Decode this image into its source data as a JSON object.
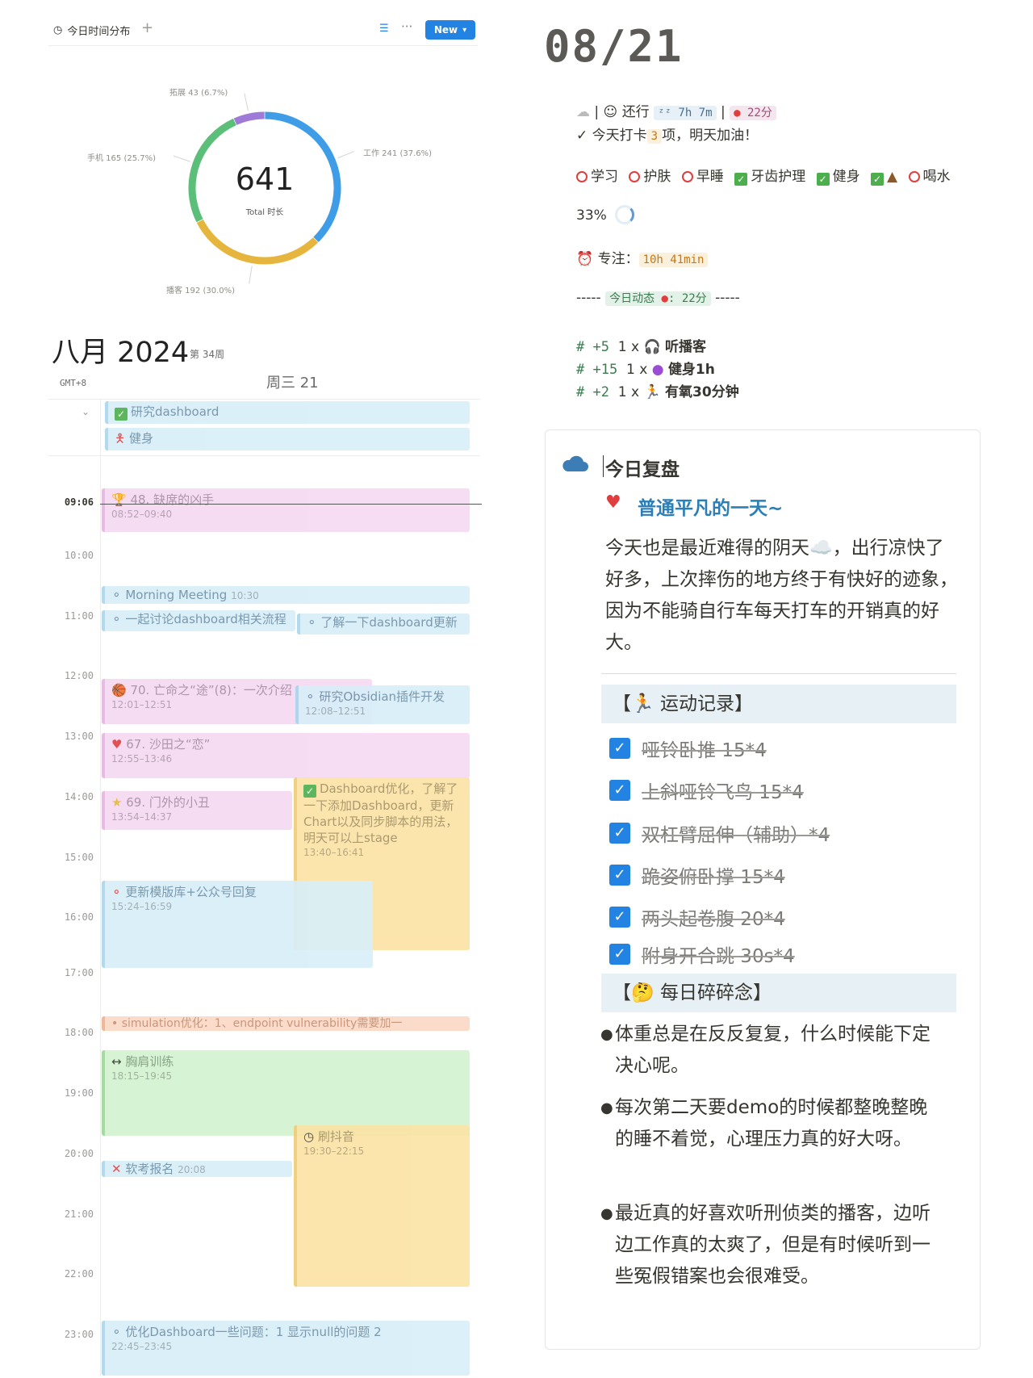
{
  "header": {
    "view_title": "今日时间分布",
    "add": "+",
    "more": "···",
    "new_label": "New"
  },
  "chart_data": {
    "type": "pie",
    "title": "",
    "total": "641",
    "total_label": "Total 时长",
    "slices": [
      {
        "name": "工作",
        "value": 241,
        "pct": "37.6%",
        "color": "#3e9de6",
        "label": "工作 241 (37.6%)"
      },
      {
        "name": "播客",
        "value": 192,
        "pct": "30.0%",
        "color": "#e5b53e",
        "label": "播客 192 (30.0%)"
      },
      {
        "name": "手机",
        "value": 165,
        "pct": "25.7%",
        "color": "#5bbf79",
        "label": "手机 165 (25.7%)"
      },
      {
        "name": "拓展",
        "value": 43,
        "pct": "6.7%",
        "color": "#a07ad8",
        "label": "拓展 43 (6.7%)"
      }
    ]
  },
  "calendar": {
    "month": "八月 2024",
    "week": "第 34周",
    "tz": "GMT+8",
    "day": "周三 21",
    "now": "09:06",
    "hours": [
      "10:00",
      "11:00",
      "12:00",
      "13:00",
      "14:00",
      "15:00",
      "16:00",
      "17:00",
      "18:00",
      "19:00",
      "20:00",
      "21:00",
      "22:00",
      "23:00"
    ],
    "allday": [
      "研究dashboard",
      "健身"
    ],
    "events": {
      "e1": {
        "title": "48. 缺席的凶手",
        "time": "08:52–09:40"
      },
      "e2": {
        "title": "Morning Meeting",
        "time": "10:30"
      },
      "e3": {
        "title": "一起讨论dashboard相关流程"
      },
      "e4": {
        "title": "了解一下dashboard更新"
      },
      "e5": {
        "title": "70. 亡命之“途”(8)：一次介绍",
        "time": "12:01–12:51"
      },
      "e6": {
        "title": "研究Obsidian插件开发",
        "time": "12:08–12:51"
      },
      "e7": {
        "title": "67. 沙田之“恋”",
        "time": "12:55–13:46"
      },
      "e8": {
        "title": "Dashboard优化，了解了一下添加Dashboard，更新Chart以及同步脚本的用法，明天可以上stage",
        "time": "13:40–16:41"
      },
      "e9": {
        "title": "69. 门外的小丑",
        "time": "13:54–14:37"
      },
      "e10": {
        "title": "更新模版库+公众号回复",
        "time": "15:24–16:59"
      },
      "e11": {
        "title": "simulation优化：1、endpoint vulnerability需要加一"
      },
      "e12": {
        "title": "胸肩训练",
        "time": "18:15–19:45"
      },
      "e13": {
        "title": "刷抖音",
        "time": "19:30–22:15"
      },
      "e14": {
        "title": "软考报名",
        "time": "20:08"
      },
      "e15": {
        "title": "优化Dashboard一些问题：1 显示null的问题 2",
        "time": "22:45–23:45"
      }
    }
  },
  "daily": {
    "date": "08/21",
    "status": {
      "transport": "还行",
      "sleep": "7h 7m",
      "score": "22分",
      "checkin_pre": "今天打卡",
      "checkin_count": "3",
      "checkin_post": "项，明天加油！"
    },
    "habits": [
      {
        "label": "学习",
        "done": false
      },
      {
        "label": "护肤",
        "done": false
      },
      {
        "label": "早睡",
        "done": false
      },
      {
        "label": "牙齿护理",
        "done": true
      },
      {
        "label": "健身",
        "done": true
      },
      {
        "label": "",
        "done": true
      },
      {
        "label": "喝水",
        "done": false
      }
    ],
    "progress": "33%",
    "focus_label": "专注：",
    "focus_value": "10h 41min",
    "dyn_dash": "-----",
    "dyn_label": "今日动态",
    "dyn_score": "22分",
    "activities": [
      {
        "pts": "# +5",
        "qty": "1 x",
        "name": "听播客"
      },
      {
        "pts": "# +15",
        "qty": "1 x",
        "name": "健身1h"
      },
      {
        "pts": "# +2",
        "qty": "1 x",
        "name": "有氧30分钟"
      }
    ]
  },
  "review": {
    "title": "今日复盘",
    "subtitle": "普通平凡的一天~",
    "para": "今天也是最近难得的阴天☁️，出行凉快了好多，上次摔伤的地方终于有快好的迹象，因为不能骑自行车每天打车的开销真的好大。",
    "exercise_head": "【🏃 运动记录】",
    "exercises": [
      "哑铃卧推 15*4",
      "上斜哑铃飞鸟 15*4",
      "双杠臂屈伸（辅助）*4",
      "跪姿俯卧撑 15*4",
      "两头起卷腹 20*4",
      "附身开合跳 30s*4"
    ],
    "notes_head": "【🤔 每日碎碎念】",
    "notes": [
      "体重总是在反反复复，什么时候能下定决心呢。",
      "每次第二天要demo的时候都整晚整晚的睡不着觉，心理压力真的好大呀。",
      "最近真的好喜欢听刑侦类的播客，边听边工作真的太爽了，但是有时候听到一些冤假错案也会很难受。"
    ]
  }
}
